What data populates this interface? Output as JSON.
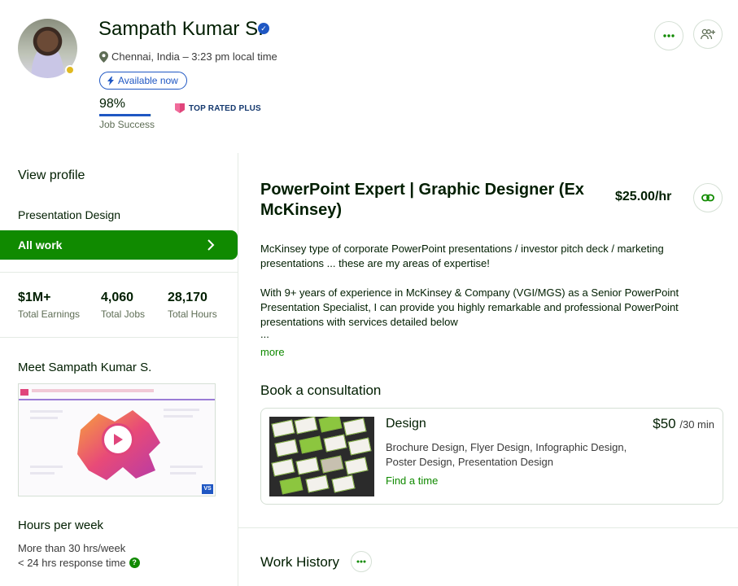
{
  "header": {
    "name": "Sampath Kumar S.",
    "location": "Chennai, India – 3:23 pm local time",
    "availability": "Available now",
    "job_success_pct": "98%",
    "job_success_value": 0.98,
    "job_success_label": "Job Success",
    "badge": "TOP RATED PLUS"
  },
  "sidebar": {
    "view_profile": "View profile",
    "specialty": "Presentation Design",
    "all_work": "All work",
    "stats": [
      {
        "value": "$1M+",
        "label": "Total Earnings"
      },
      {
        "value": "4,060",
        "label": "Total Jobs"
      },
      {
        "value": "28,170",
        "label": "Total Hours"
      }
    ],
    "meet_title": "Meet Sampath Kumar S.",
    "hours_title": "Hours per week",
    "hours_value": "More than 30 hrs/week",
    "response_time": "< 24 hrs response time"
  },
  "main": {
    "title": "PowerPoint Expert | Graphic Designer (Ex McKinsey)",
    "rate": "$25.00/hr",
    "description_1": "McKinsey type of corporate PowerPoint presentations / investor pitch deck / marketing presentations ... these are my areas of expertise!",
    "description_2": "With 9+ years of experience in McKinsey & Company (VGI/MGS) as a Senior PowerPoint Presentation Specialist, I can provide you highly remarkable and professional PowerPoint presentations with services detailed below",
    "ellipsis": "...",
    "more": "more",
    "book_title": "Book a consultation",
    "consultation": {
      "title": "Design",
      "price": "$50",
      "duration": "/30 min",
      "tags": "Brochure Design, Flyer Design, Infographic Design, Poster Design, Presentation Design",
      "cta": "Find a time"
    },
    "work_history": "Work History"
  },
  "colors": {
    "brand_green": "#108a00",
    "accent_blue": "#1f57c3",
    "badge_pink": "#e0457b",
    "status_yellow": "#e0b921"
  }
}
